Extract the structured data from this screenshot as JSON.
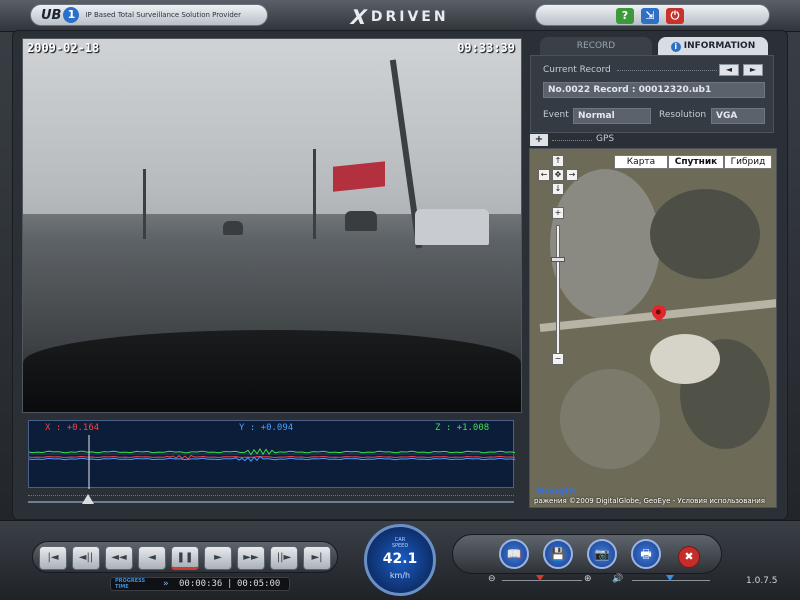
{
  "title_bar": {
    "brand_ub": "UB",
    "brand_one": "1",
    "brand_tagline": "IP Based Total Surveillance Solution Provider",
    "logo_x": "X",
    "logo_text": "DRIVEN",
    "buttons": {
      "help": "?",
      "minimize": "⇲",
      "close": "⏻"
    }
  },
  "video": {
    "date": "2009-02-18",
    "time": "09:33:39"
  },
  "gsensor": {
    "x_label": "X : +0.164",
    "y_label": "Y : +0.094",
    "z_label": "Z : +1.008",
    "colors": {
      "x": "#ff4040",
      "y": "#4aa0ff",
      "z": "#3ee04a"
    }
  },
  "tabs": {
    "record": "RECORD",
    "information": "INFORMATION",
    "active": "information"
  },
  "info": {
    "current_record_label": "Current Record",
    "prev": "◄",
    "next": "►",
    "record_value": "No.0022 Record : 00012320.ub1",
    "event_label": "Event",
    "event_value": "Normal",
    "resolution_label": "Resolution",
    "resolution_value": "VGA"
  },
  "gps": {
    "plus": "+",
    "label": "GPS",
    "map_types": [
      "Карта",
      "Спутник",
      "Гибрид"
    ],
    "active_map_type": "Спутник",
    "pan": {
      "up": "↑",
      "left": "←",
      "center": "✥",
      "right": "→",
      "down": "↓"
    },
    "zoom_in": "+",
    "zoom_out": "−",
    "google": "Google",
    "copyright": "ражения ©2009 DigitalGlobe, GeoEye - Условия использования"
  },
  "playback": {
    "buttons": [
      "|◄",
      "◄||",
      "◄◄",
      "◄",
      "❚❚",
      "►",
      "►►",
      "||►",
      "►|"
    ],
    "active_index": 4,
    "progress_label_1": "PROGRESS",
    "progress_label_2": "TIME",
    "current_time": "00:00:36",
    "total_time": "00:05:00",
    "time_separator": "|"
  },
  "speed": {
    "label_1": "CAR",
    "label_2": "SPEED",
    "value": "42.1",
    "unit": "km/h"
  },
  "tools": {
    "buttons": [
      "📖",
      "💾",
      "📷",
      "🖶"
    ],
    "settings": "✖",
    "zoom_minus": "⊖",
    "zoom_plus": "⊕",
    "volume_icon": "🔊"
  },
  "version": "1.0.7.5"
}
